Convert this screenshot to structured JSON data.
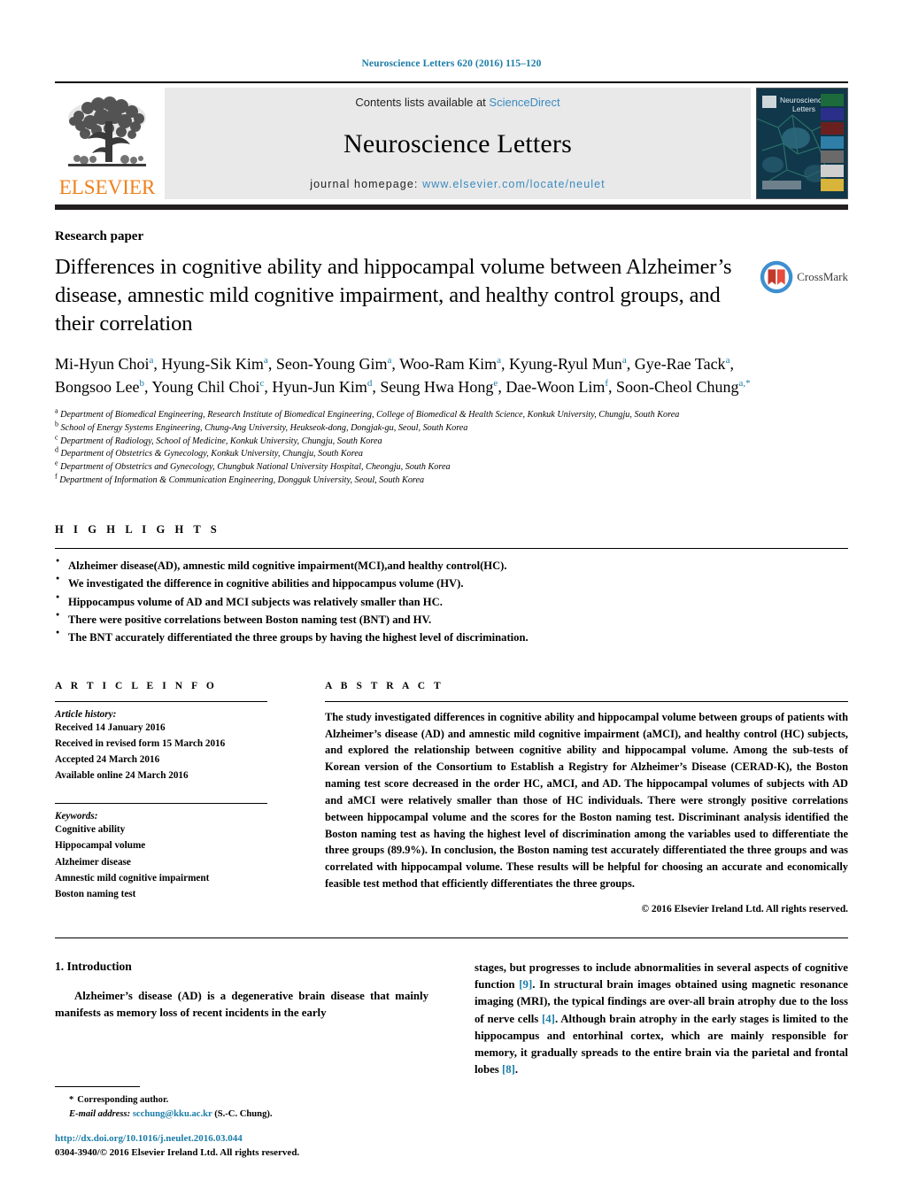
{
  "running_head": "Neuroscience Letters 620 (2016) 115–120",
  "masthead": {
    "publisher": "ELSEVIER",
    "contents_prefix": "Contents lists available at ",
    "contents_link": "ScienceDirect",
    "journal_name": "Neuroscience Letters",
    "homepage_prefix": "journal homepage: ",
    "homepage_url": "www.elsevier.com/locate/neulet",
    "cover_title_line1": "Neuroscience",
    "cover_title_line2": "Letters"
  },
  "article": {
    "paper_type": "Research paper",
    "crossmark_label": "CrossMark",
    "title": "Differences in cognitive ability and hippocampal volume between Alzheimer’s disease, amnestic mild cognitive impairment, and healthy control groups, and their correlation",
    "authors_html": "Mi-Hyun Choi<sup>a</sup>, Hyung-Sik Kim<sup>a</sup>, Seon-Young Gim<sup>a</sup>, Woo-Ram Kim<sup>a</sup>, Kyung-Ryul Mun<sup>a</sup>, Gye-Rae Tack<sup>a</sup>, Bongsoo Lee<sup>b</sup>, Young Chil Choi<sup>c</sup>, Hyun-Jun Kim<sup>d</sup>, Seung Hwa Hong<sup>e</sup>, Dae-Woon Lim<sup>f</sup>, Soon-Cheol Chung<sup>a,</sup><sup>*</sup>",
    "affiliations": [
      {
        "marker": "a",
        "text": "Department of Biomedical Engineering, Research Institute of Biomedical Engineering, College of Biomedical & Health Science, Konkuk University, Chungju, South Korea"
      },
      {
        "marker": "b",
        "text": "School of Energy Systems Engineering, Chung-Ang University, Heukseok-dong, Dongjak-gu, Seoul, South Korea"
      },
      {
        "marker": "c",
        "text": "Department of Radiology, School of Medicine, Konkuk University, Chungju, South Korea"
      },
      {
        "marker": "d",
        "text": "Department of Obstetrics & Gynecology, Konkuk University, Chungju, South Korea"
      },
      {
        "marker": "e",
        "text": "Department of Obstetrics and Gynecology, Chungbuk National University Hospital, Cheongju, South Korea"
      },
      {
        "marker": "f",
        "text": "Department of Information & Communication Engineering, Dongguk University, Seoul, South Korea"
      }
    ]
  },
  "highlights": {
    "heading": "H I G H L I G H T S",
    "items": [
      "Alzheimer disease(AD), amnestic mild cognitive impairment(MCI),and healthy control(HC).",
      "We investigated the difference in cognitive abilities and hippocampus volume (HV).",
      "Hippocampus volume of AD and MCI subjects was relatively smaller than HC.",
      "There were positive correlations between Boston naming test (BNT) and HV.",
      "The BNT accurately differentiated the three groups by having the highest level of discrimination."
    ]
  },
  "article_info": {
    "heading": "A R T I C L E  I N F O",
    "history_label": "Article history:",
    "history": [
      "Received 14 January 2016",
      "Received in revised form 15 March 2016",
      "Accepted 24 March 2016",
      "Available online 24 March 2016"
    ],
    "keywords_label": "Keywords:",
    "keywords": [
      "Cognitive ability",
      "Hippocampal volume",
      "Alzheimer disease",
      "Amnestic mild cognitive impairment",
      "Boston naming test"
    ]
  },
  "abstract": {
    "heading": "A B S T R A C T",
    "text": "The study investigated differences in cognitive ability and hippocampal volume between groups of patients with Alzheimer’s disease (AD) and amnestic mild cognitive impairment (aMCI), and healthy control (HC) subjects, and explored the relationship between cognitive ability and hippocampal volume. Among the sub-tests of Korean version of the Consortium to Establish a Registry for Alzheimer’s Disease (CERAD-K), the Boston naming test score decreased in the order HC, aMCI, and AD. The hippocampal volumes of subjects with AD and aMCI were relatively smaller than those of HC individuals. There were strongly positive correlations between hippocampal volume and the scores for the Boston naming test. Discriminant analysis identified the Boston naming test as having the highest level of discrimination among the variables used to differentiate the three groups (89.9%). In conclusion, the Boston naming test accurately differentiated the three groups and was correlated with hippocampal volume. These results will be helpful for choosing an accurate and economically feasible test method that efficiently differentiates the three groups.",
    "copyright": "© 2016 Elsevier Ireland Ltd. All rights reserved."
  },
  "introduction": {
    "heading": "1.  Introduction",
    "left_paragraph": "Alzheimer’s disease (AD) is a degenerative brain disease that mainly manifests as memory loss of recent incidents in the early",
    "right_paragraph_parts": [
      {
        "type": "text",
        "value": "stages, but progresses to include abnormalities in several aspects of cognitive function "
      },
      {
        "type": "ref",
        "value": "[9]"
      },
      {
        "type": "text",
        "value": ". In structural brain images obtained using magnetic resonance imaging (MRI), the typical findings are over-all brain atrophy due to the loss of nerve cells "
      },
      {
        "type": "ref",
        "value": "[4]"
      },
      {
        "type": "text",
        "value": ". Although brain atrophy in the early stages is limited to the hippocampus and entorhinal cortex, which are mainly responsible for memory, it gradually spreads to the entire brain via the parietal and frontal lobes "
      },
      {
        "type": "ref",
        "value": "[8]"
      },
      {
        "type": "text",
        "value": "."
      }
    ]
  },
  "footer": {
    "corresponding_star": "*",
    "corresponding_text": "Corresponding author.",
    "email_label": "E-mail address:",
    "email": "scchung@kku.ac.kr",
    "email_suffix": "(S.-C. Chung).",
    "doi": "http://dx.doi.org/10.1016/j.neulet.2016.03.044",
    "issn_line": "0304-3940/© 2016 Elsevier Ireland Ltd. All rights reserved."
  },
  "colors": {
    "link": "#1a7ca8",
    "masthead_link": "#3a8bbf",
    "elsevier_orange": "#f0801a",
    "masthead_bg": "#e9e9e9"
  }
}
